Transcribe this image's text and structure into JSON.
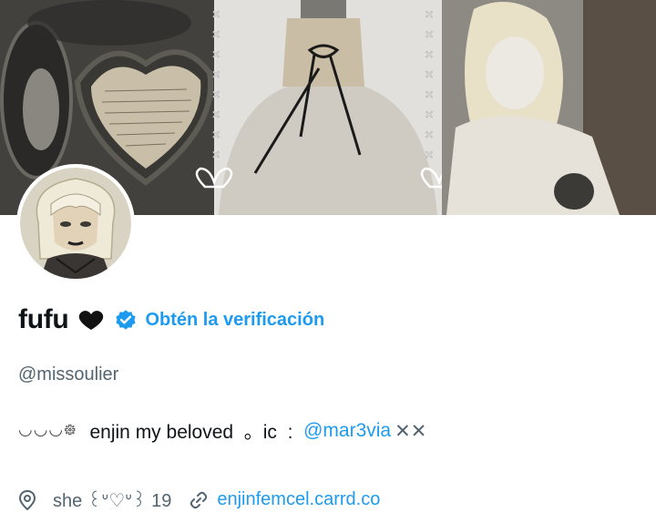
{
  "profile": {
    "display_name": "fufu",
    "heart_icon": "black-heart-icon",
    "verified_icon": "verified-badge-icon",
    "get_verified_label": "Obtén la verificación",
    "handle": "@missoulier"
  },
  "bio": {
    "deco_prefix": "◡◡◡᪥",
    "text": "enjin my beloved  。ic  :  ",
    "mention": "@mar3via",
    "suffix": "✕✕"
  },
  "meta": {
    "location_icon": "location-pin-icon",
    "location_text": "she ꒰ᐡ♡ᐡ꒱ 19",
    "link_icon": "link-icon",
    "link_text": "enjinfemcel.carrd.co"
  },
  "colors": {
    "accent": "#1d9bf0",
    "secondary_text": "#536471",
    "primary_text": "#0f1419"
  }
}
